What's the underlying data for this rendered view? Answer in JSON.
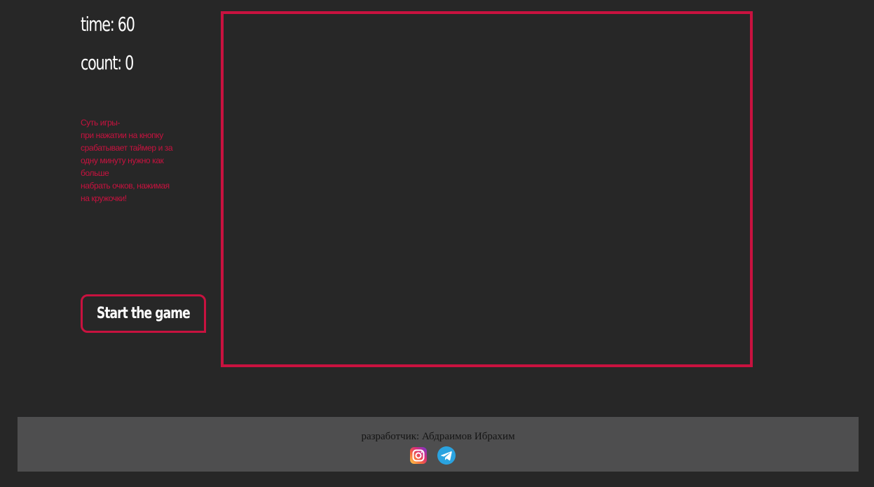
{
  "stats": {
    "time_label": "time: 60",
    "count_label": "count: 0"
  },
  "rules": {
    "lines": [
      "Суть игры-",
      "при нажатии на кнопку",
      "срабатывает таймер и за",
      "одну минуту нужно как",
      "больше",
      "набрать очков, нажимая",
      "на кружочки!"
    ]
  },
  "controls": {
    "start_label": "Start the game"
  },
  "footer": {
    "credit": "разработчик: Абдраимов Ибрахим",
    "social": [
      {
        "icon": "instagram-icon"
      },
      {
        "icon": "telegram-icon"
      }
    ]
  },
  "colors": {
    "background": "#272727",
    "accent": "#c8123f",
    "footer_bg": "#4e4e4f",
    "text": "#ffffff"
  }
}
